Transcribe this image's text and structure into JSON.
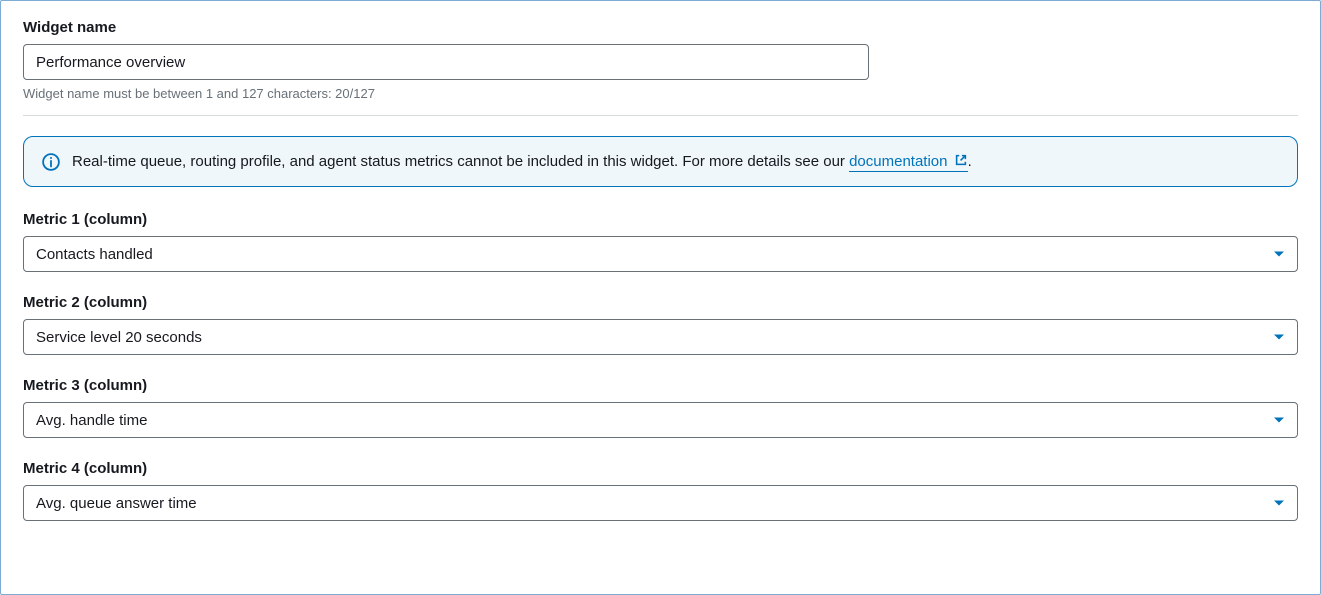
{
  "widgetName": {
    "label": "Widget name",
    "value": "Performance overview",
    "helper": "Widget name must be between 1 and 127 characters: 20/127"
  },
  "infoAlert": {
    "textBefore": "Real-time queue, routing profile, and agent status metrics cannot be included in this widget. For more details see our ",
    "linkText": "documentation",
    "textAfter": "."
  },
  "metrics": [
    {
      "label": "Metric 1 (column)",
      "value": "Contacts handled"
    },
    {
      "label": "Metric 2 (column)",
      "value": "Service level 20 seconds"
    },
    {
      "label": "Metric 3 (column)",
      "value": "Avg. handle time"
    },
    {
      "label": "Metric 4 (column)",
      "value": "Avg. queue answer time"
    }
  ],
  "colors": {
    "accent": "#0073bb",
    "border": "#687078",
    "panelBorder": "#7dabd4",
    "alertBg": "#f0f7fb"
  }
}
